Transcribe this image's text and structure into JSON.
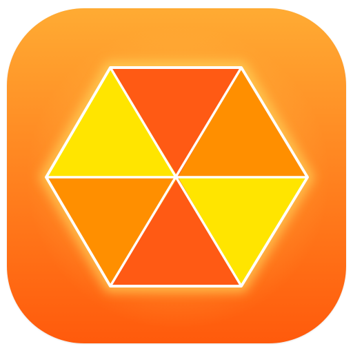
{
  "icon": {
    "name": "hexagon-triangles-app-icon",
    "colors": {
      "background_top": "#ffab33",
      "background_bottom": "#ff5a0c",
      "glow": "#ffd65c",
      "outline": "#ffffff",
      "triangle_yellow": "#ffe500",
      "triangle_orange": "#ff8f00",
      "triangle_red_orange": "#ff5a14"
    },
    "segments": [
      {
        "id": "top",
        "color": "triangle_red_orange"
      },
      {
        "id": "upper-right",
        "color": "triangle_orange"
      },
      {
        "id": "lower-right",
        "color": "triangle_yellow"
      },
      {
        "id": "bottom",
        "color": "triangle_red_orange"
      },
      {
        "id": "lower-left",
        "color": "triangle_orange"
      },
      {
        "id": "upper-left",
        "color": "triangle_yellow"
      }
    ]
  }
}
